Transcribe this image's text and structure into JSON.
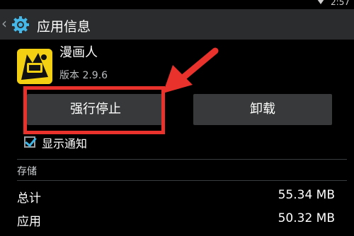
{
  "status_bar": {
    "time": "2:57"
  },
  "action_bar": {
    "title": "应用信息"
  },
  "app": {
    "name": "漫画人",
    "version": "版本 2.9.6"
  },
  "buttons": {
    "force_stop": "强行停止",
    "uninstall": "卸载"
  },
  "notifications": {
    "label": "显示通知",
    "checked": true
  },
  "storage": {
    "section_title": "存储",
    "rows": [
      {
        "label": "总计",
        "value": "55.34 MB"
      },
      {
        "label": "应用",
        "value": "50.32 MB"
      }
    ]
  },
  "colors": {
    "accent": "#3fb5e5",
    "highlight": "#e8322b",
    "button": "#38393a",
    "app_icon": "#f3d011"
  }
}
